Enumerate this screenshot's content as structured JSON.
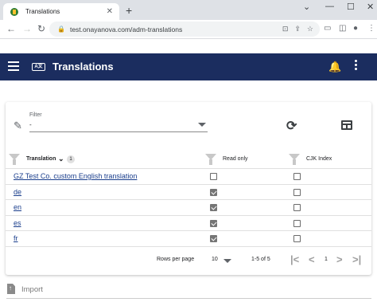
{
  "browser": {
    "tab_title": "Translations",
    "tab_close": "✕",
    "new_tab": "+",
    "url": "test.onayanova.com/adm-translations",
    "window_controls": [
      "⌄",
      "—",
      "☐",
      "✕"
    ]
  },
  "app": {
    "title": "Translations",
    "header_color": "#1b2d5f"
  },
  "filter": {
    "label": "Filter",
    "value": "-"
  },
  "table": {
    "columns": {
      "translation": "Translation",
      "translation_sort_badge": "1",
      "read_only": "Read only",
      "cjk_index": "CJK Index"
    },
    "rows": [
      {
        "name": "GZ Test Co. custom English translation",
        "read_only": false,
        "cjk_index": false
      },
      {
        "name": "de",
        "read_only": true,
        "cjk_index": false
      },
      {
        "name": "en",
        "read_only": true,
        "cjk_index": false
      },
      {
        "name": "es",
        "read_only": true,
        "cjk_index": false
      },
      {
        "name": "fr",
        "read_only": true,
        "cjk_index": false
      }
    ]
  },
  "pagination": {
    "rows_per_page_label": "Rows per page",
    "rows_per_page_value": "10",
    "range": "1-5 of 5",
    "page": "1"
  },
  "import": {
    "label": "Import"
  }
}
